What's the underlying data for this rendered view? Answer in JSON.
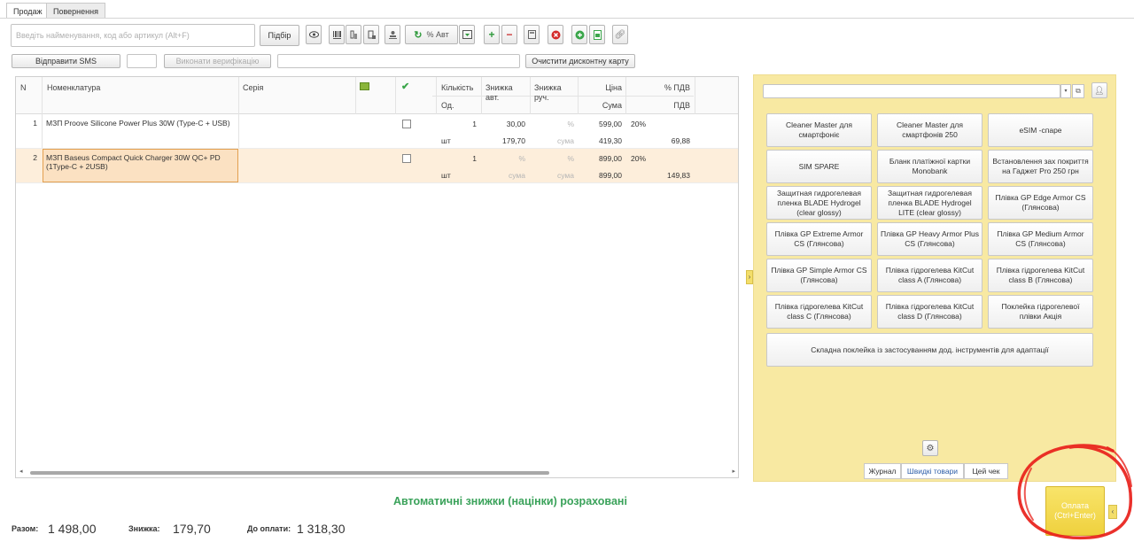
{
  "tabs": [
    "Продаж",
    "Повернення"
  ],
  "toolbar": {
    "search_placeholder": "Введіть найменування, код або артикул (Alt+F)",
    "pick_label": "Підбір",
    "auto_percent_label": "% Авт",
    "send_sms_label": "Відправити SMS",
    "verify_label": "Виконати верифікацію",
    "clear_card_label": "Очистити дисконтну карту"
  },
  "grid": {
    "headers": {
      "n": "N",
      "nomenclature": "Номенклатура",
      "series": "Серія",
      "qty": "Кількість",
      "unit": "Од.",
      "disc_auto": "Знижка авт.",
      "disc_manual": "Знижка руч.",
      "price": "Ціна",
      "sum": "Сума",
      "vat_pct": "% ПДВ",
      "vat": "ПДВ"
    },
    "rows": [
      {
        "n": "1",
        "name": "МЗП Proove Silicone Power Plus 30W (Type-C + USB)",
        "qty": "1",
        "unit": "шт",
        "disc_auto": "30,00",
        "disc_auto_sum": "179,70",
        "disc_manual": "%",
        "disc_manual_sum": "сума",
        "price": "599,00",
        "sum": "419,30",
        "vat_pct": "20%",
        "vat": "69,88"
      },
      {
        "n": "2",
        "name": "МЗП Baseus Compact Quick Charger 30W QC+ PD (1Type-C + 2USB)",
        "qty": "1",
        "unit": "шт",
        "disc_auto": "%",
        "disc_auto_sum": "сума",
        "disc_manual": "%",
        "disc_manual_sum": "сума",
        "price": "899,00",
        "sum": "899,00",
        "vat_pct": "20%",
        "vat": "149,83"
      }
    ]
  },
  "quick_goods": [
    "Cleaner Master для смартфоніє",
    "Cleaner Master для смартфонів 250",
    "eSIM -спаре",
    "SIM SPARE",
    "Бланк платіжної картки Monobank",
    "Встановлення зах покриття на Гаджет Pro 250 грн",
    "Защитная гидрогелевая пленка BLADE Hydrogel (clear glossy)",
    "Защитная гидрогелевая пленка BLADE Hydrogel LITE (clear glossy)",
    "Плівка GP Edge Armor CS (Глянсова)",
    "Плівка GP Extreme Armor CS (Глянсова)",
    "Плівка GP Heavy Armor Plus CS (Глянсова)",
    "Плівка GP Medium Armor CS (Глянсова)",
    "Плівка GP Simple Armor CS (Глянсова)",
    "Плівка гідрогелева KitCut class A (Глянсова)",
    "Плівка гідрогелева KitCut class B (Глянсова)",
    "Плівка гідрогелева KitCut class C (Глянсова)",
    "Плівка гідрогелева KitCut class D (Глянсова)",
    "Поклейка гідрогелевої плівки Акція",
    "Складна поклейка із застосуванням дод. інструментів для адаптації"
  ],
  "panel_tabs": [
    "Журнал",
    "Швидкі товари",
    "Цей чек"
  ],
  "status_message": "Автоматичні знижки (націнки) розраховані",
  "totals": {
    "total_label": "Разом:",
    "total_value": "1 498,00",
    "discount_label": "Знижка:",
    "discount_value": "179,70",
    "to_pay_label": "До оплати:",
    "to_pay_value": "1 318,30"
  },
  "pay_button": {
    "line1": "Оплата",
    "line2": "(Ctrl+Enter)"
  },
  "colors": {
    "panel_bg": "#f8e9a2",
    "selected_row": "#fdeedb",
    "status_green": "#3aa25a",
    "pay_button": "#f5dc55",
    "annotation_red": "#e8201a"
  }
}
